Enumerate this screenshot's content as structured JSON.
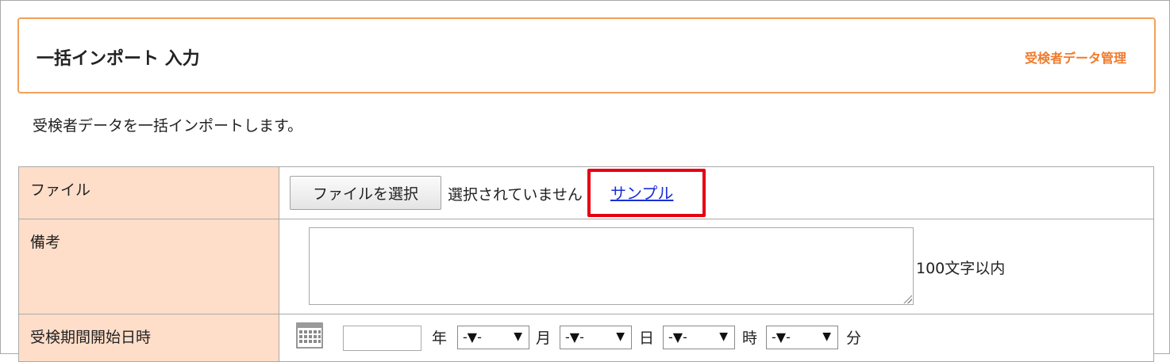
{
  "header": {
    "title": "一括インポート 入力",
    "section_link": "受検者データ管理",
    "accent_color": "#f2a05a"
  },
  "description": "受検者データを一括インポートします。",
  "form": {
    "file": {
      "label": "ファイル",
      "button_label": "ファイルを選択",
      "status_text": "選択されていません",
      "sample_link": "サンプル",
      "highlight_color": "#e50012"
    },
    "note": {
      "label": "備考",
      "value": "",
      "hint": "100文字以内"
    },
    "start_datetime": {
      "label": "受検期間開始日時",
      "calendar_icon": "calendar-icon",
      "year_value": "",
      "units": {
        "year": "年",
        "month": "月",
        "day": "日",
        "hour": "時",
        "minute": "分"
      },
      "month_select": "-▼-",
      "day_select": "-▼-",
      "hour_select": "-▼-",
      "minute_select": "-▼-"
    }
  }
}
